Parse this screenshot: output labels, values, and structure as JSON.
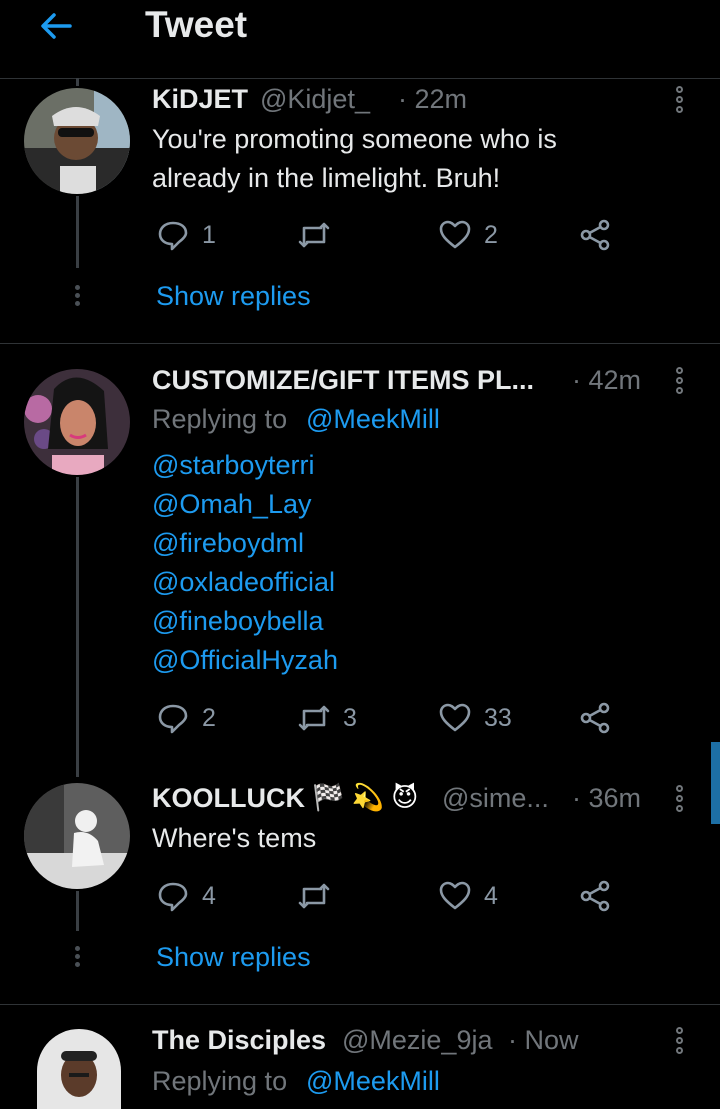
{
  "header": {
    "title": "Tweet"
  },
  "tweets": [
    {
      "name": "KiDJET",
      "handle": "@Kidjet_",
      "time": "· 22m",
      "text": "You're promoting someone who is already in the limelight. Bruh!",
      "replies": "1",
      "retweets": "",
      "likes": "2",
      "show_replies": "Show replies"
    },
    {
      "name": "CUSTOMIZE/GIFT ITEMS PL...",
      "handle": "",
      "time": "· 42m",
      "replying_prefix": "Replying to",
      "replying_to": "@MeekMill",
      "mentions": [
        "@starboyterri",
        "@Omah_Lay",
        "@fireboydml",
        "@oxladeofficial",
        "@fineboybella",
        "@OfficialHyzah"
      ],
      "replies": "2",
      "retweets": "3",
      "likes": "33"
    },
    {
      "name": "KOOLLUCK",
      "emojis": "🏁 💫 😈",
      "handle": "@sime...",
      "time": "· 36m",
      "text": "Where's tems",
      "replies": "4",
      "retweets": "",
      "likes": "4",
      "show_replies": "Show replies"
    },
    {
      "name": "The Disciples",
      "handle": "@Mezie_9ja",
      "time": "· Now",
      "replying_prefix": "Replying to",
      "replying_to": "@MeekMill"
    }
  ],
  "colors": {
    "link": "#1d9bf0",
    "muted": "#71767b",
    "background": "#000000"
  }
}
